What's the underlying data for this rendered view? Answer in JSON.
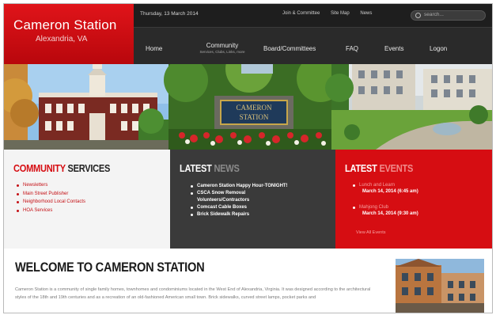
{
  "site": {
    "title": "Cameron Station",
    "subtitle": "Alexandria, VA"
  },
  "topbar": {
    "date": "Thursday, 13 March 2014",
    "links": [
      "Join & Committee",
      "Site Map",
      "News"
    ],
    "search_placeholder": "search..."
  },
  "nav": {
    "home": "Home",
    "community": "Community",
    "community_sub": "Services, Clubs, Links, more",
    "board": "Board/Committees",
    "faq": "FAQ",
    "events": "Events",
    "logon": "Logon"
  },
  "hero": {
    "sign_line1": "CAMERON",
    "sign_line2": "STATION"
  },
  "services": {
    "title_a": "COMMUNITY",
    "title_b": " SERVICES",
    "items": [
      "Newsletters",
      "Main Street Publisher",
      "Neighborhood Local Contacts",
      "HOA Services"
    ]
  },
  "news": {
    "title_a": "LATEST",
    "title_b": " NEWS",
    "items": [
      "Cameron Station Happy Hour-TONIGHT!",
      "CSCA Snow Removal",
      "Volunteers/Contractors",
      "Comcast Cable Boxes",
      "Brick Sidewalk Repairs"
    ]
  },
  "events": {
    "title_a": "LATEST",
    "title_b": " EVENTS",
    "items": [
      {
        "name": "Lunch and Learn",
        "when": "March 14, 2014 (6:45 am)"
      },
      {
        "name": "Mahjong Club",
        "when": "March 14, 2014 (9:30 am)"
      }
    ],
    "more": "View All Events"
  },
  "welcome": {
    "title": "WELCOME TO CAMERON STATION",
    "text": "Cameron Station is a community of single family homes, townhomes and condominiums located in the West End of Alexandria, Virginia. It was designed according to the architectural styles of the 18th and 19th centuries and as a recreation of an old-fashioned American small town. Brick sidewalks, curved street lamps, pocket parks and"
  },
  "colors": {
    "brand_red": "#d60d12",
    "header_dark": "#2a2a2a",
    "news_panel": "#3a3a3a"
  }
}
